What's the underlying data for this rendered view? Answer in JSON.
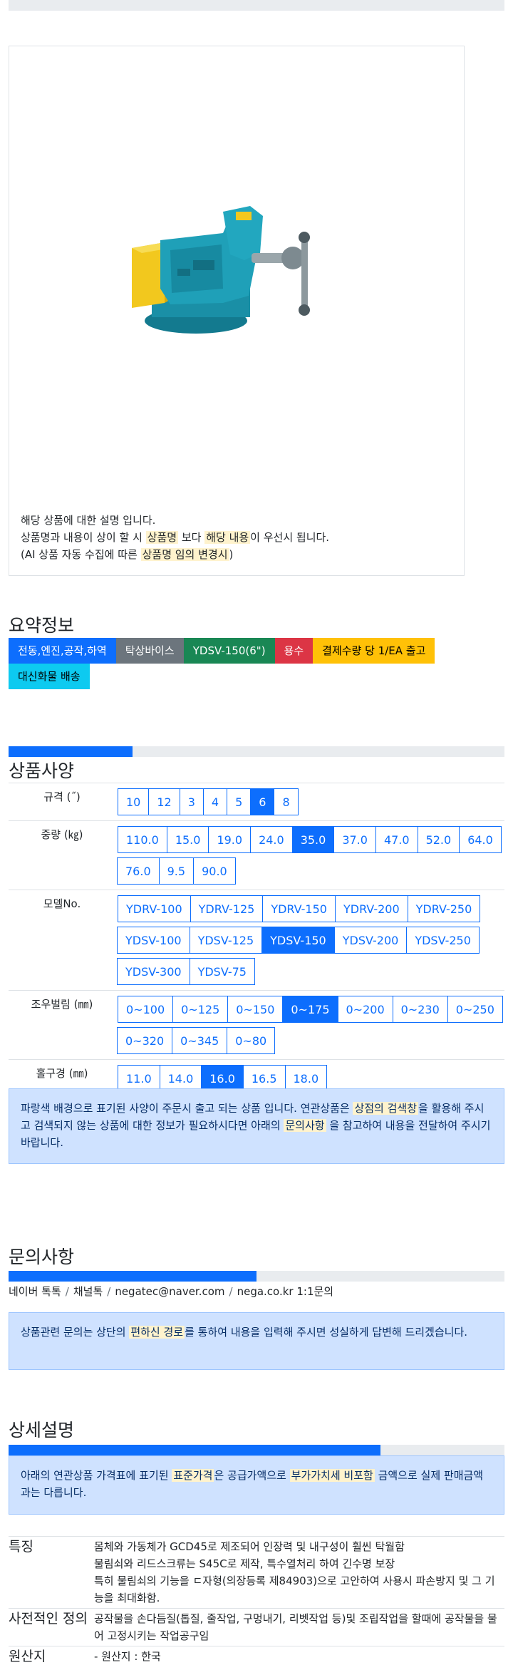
{
  "image_note": {
    "line1": "해당 상품에 대한 설명 입니다.",
    "line2_a": "상품명과 내용이 상이 할 시 ",
    "line2_hl1": "상품명",
    "line2_b": " 보다 ",
    "line2_hl2": "해당 내용",
    "line2_c": "이 우선시 됩니다.",
    "line3_a": "(AI 상품 자동 수집에 따른 ",
    "line3_hl": "상품명 임의 변경시",
    "line3_b": ")"
  },
  "summary": {
    "title": "요약정보",
    "badges": [
      {
        "label": "전동,엔진,공작,하역",
        "color": "#0d6efd",
        "text_color": "#ffffff"
      },
      {
        "label": "탁상바이스",
        "color": "#6c757d",
        "text_color": "#ffffff"
      },
      {
        "label": "YDSV-150(6\")",
        "color": "#198754",
        "text_color": "#ffffff"
      },
      {
        "label": "용수",
        "color": "#dc3545",
        "text_color": "#ffffff"
      },
      {
        "label": "결제수량 당 1/EA 출고",
        "color": "#ffc107",
        "text_color": "#000000"
      },
      {
        "label": "대신화물 배송",
        "color": "#0dcaf0",
        "text_color": "#000000"
      }
    ]
  },
  "spec": {
    "title": "상품사양",
    "progress": 0.25,
    "rows": [
      {
        "label": "규격 (˝)",
        "options": [
          "10",
          "12",
          "3",
          "4",
          "5",
          "6",
          "8"
        ],
        "selected": "6"
      },
      {
        "label": "중량 (㎏)",
        "options": [
          "110.0",
          "15.0",
          "19.0",
          "24.0",
          "35.0",
          "37.0",
          "47.0",
          "52.0",
          "64.0",
          "76.0",
          "9.5",
          "90.0"
        ],
        "selected": "35.0"
      },
      {
        "label": "모델No.",
        "options": [
          "YDRV-100",
          "YDRV-125",
          "YDRV-150",
          "YDRV-200",
          "YDRV-250",
          "YDSV-100",
          "YDSV-125",
          "YDSV-150",
          "YDSV-200",
          "YDSV-250",
          "YDSV-300",
          "YDSV-75"
        ],
        "selected": "YDSV-150"
      },
      {
        "label": "조우벌림 (㎜)",
        "options": [
          "0~100",
          "0~125",
          "0~150",
          "0~175",
          "0~200",
          "0~230",
          "0~250",
          "0~320",
          "0~345",
          "0~80"
        ],
        "selected": "0~175"
      },
      {
        "label": "홀구경 (㎜)",
        "options": [
          "11.0",
          "14.0",
          "16.0",
          "16.5",
          "18.0"
        ],
        "selected": "16.0"
      }
    ],
    "note_a": "파랑색 배경으로 표기된 사양이 주문시 출고 되는 상품 입니다. 연관상품은 ",
    "note_hl1": "상점의 검색창",
    "note_b": "을 활용해 주시고 검색되지 않는 상품에 대한 정보가 필요하시다면 아래의 ",
    "note_hl2": "문의사항",
    "note_c": " 을 참고하여 내용을 전달하여 주시기 바랍니다."
  },
  "inquiry": {
    "title": "문의사항",
    "progress": 0.5,
    "links": [
      "네이버 톡톡",
      "채널톡",
      "negatec@naver.com",
      "nega.co.kr 1:1문의"
    ],
    "separator": "/",
    "note_a": "상품관련 문의는 상단의 ",
    "note_hl": "편하신 경로",
    "note_b": "를 통하여 내용을 입력해 주시면 성실하게 답변해 드리겠습니다."
  },
  "detail": {
    "title": "상세설명",
    "progress": 0.75,
    "note_a": "아래의 연관상품 가격표에 표기된 ",
    "note_hl1": "표준가격",
    "note_b": "은 공급가액으로 ",
    "note_hl2": "부가가치세 비포함",
    "note_c": " 금액으로 실제 판매금액과는 다릅니다.",
    "rows": [
      {
        "label": "특징",
        "lines": [
          "몸체와 가동체가 GCD45로 제조되어 인장력 및 내구성이 훨씬 탁월함",
          "물림쇠와 리드스크류는 S45C로 제작, 특수열처리 하여 긴수명 보장",
          "특히 물림쇠의 기능을 ㄷ자형(의장등록 제84903)으로 고안하여 사용시 파손방지 및 그 기능을 최대화함."
        ]
      },
      {
        "label": "사전적인 정의",
        "lines": [
          "공작물을 손다듬질(톱질, 줄작업, 구멍내기, 리벳작업 등)및 조립작업을 할때에 공작물을 물어 고정시키는 작업공구임"
        ]
      },
      {
        "label": "원산지",
        "lines": [
          "- 원산지 : 한국"
        ]
      }
    ]
  },
  "product_image": {
    "icon": "bench-vise-image",
    "body_color": "#1a8fa6",
    "jaw_color": "#f0c419"
  }
}
